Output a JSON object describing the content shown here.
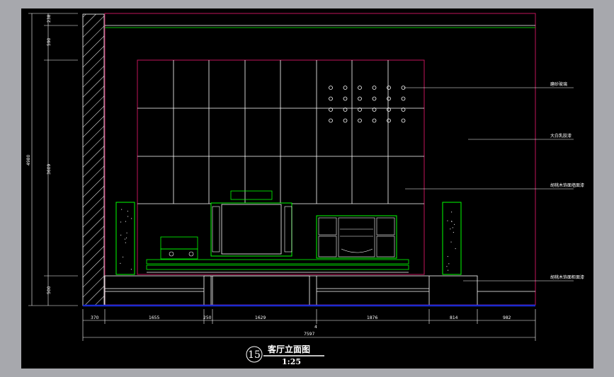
{
  "drawing": {
    "title": "客厅立面图",
    "scale": "1:25",
    "number": "15"
  },
  "annotations": {
    "note1": "磨砂玻璃",
    "note2": "大白乳胶漆",
    "note3": "胡桃木饰面墙面漆",
    "note4": "胡桃木饰面柜面漆"
  },
  "dimensions": {
    "bottom": [
      "370",
      "1655",
      "250",
      "1629",
      "1876",
      "814",
      "982"
    ],
    "total": "7597",
    "left": [
      "238",
      "590",
      "3609",
      "500"
    ],
    "left_total": "4980",
    "mid_mark": "4"
  },
  "colors": {
    "background": "#000000",
    "frame": "#a7a8ad",
    "wall": "#c0145a",
    "grid": "#ffffff",
    "equipment": "#00ff00",
    "floor": "#1a2bd0"
  }
}
